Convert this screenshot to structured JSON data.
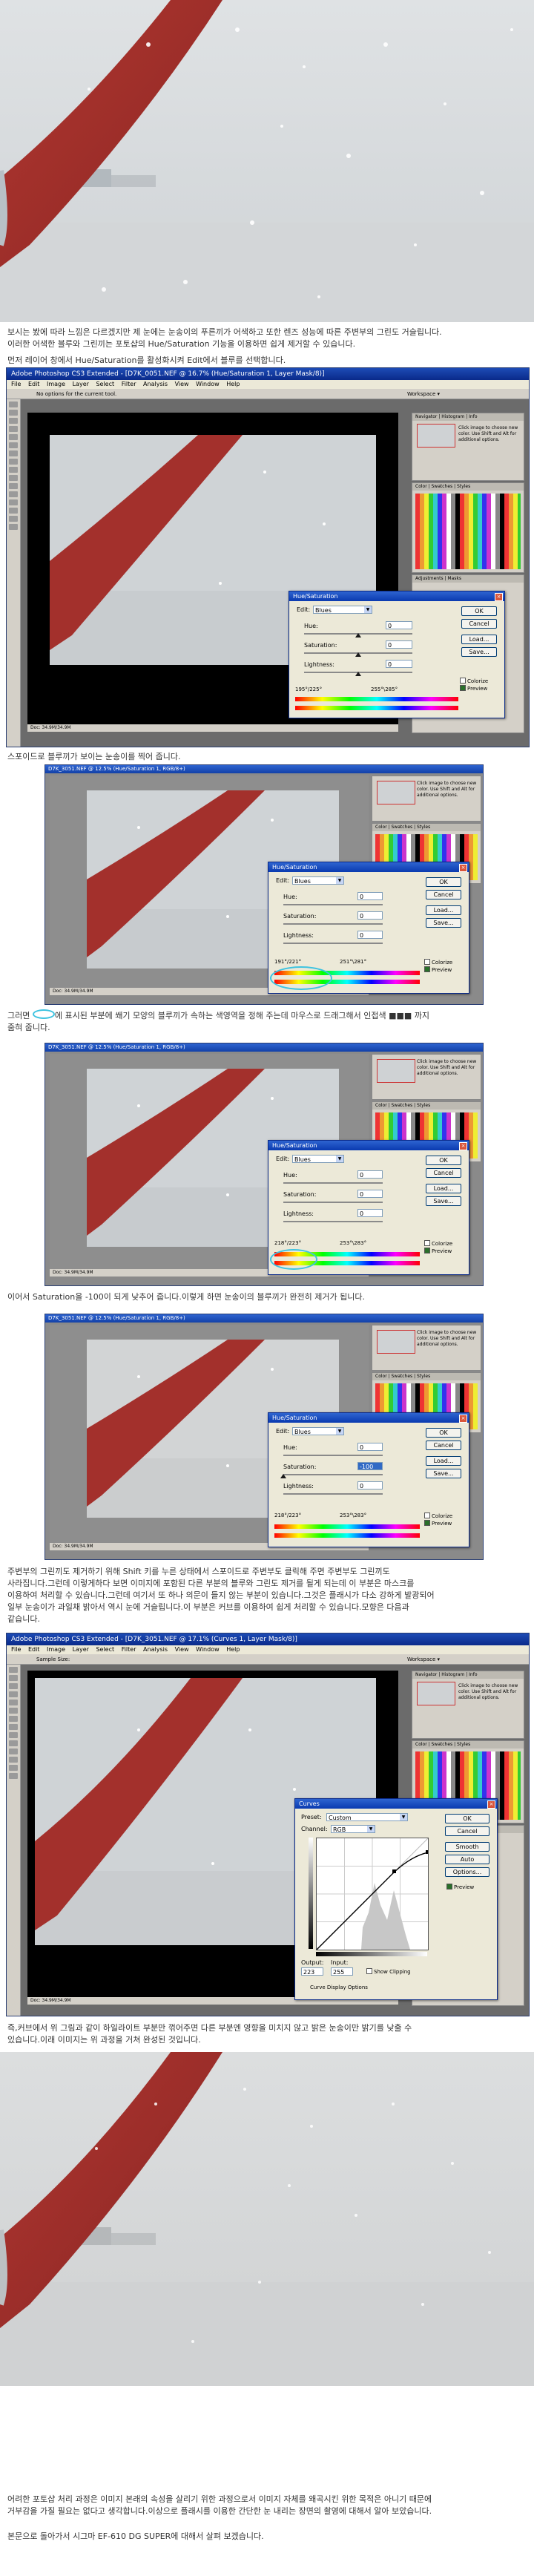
{
  "intro": {
    "line1": "보시는 봤에 따라 느낌은 다르겠지만 제 눈에는 눈송이의 푸른끼가 어색하고 또한 렌즈 성능에 따른 주변부의 그린도 거슬립니다.",
    "line2": "이러한 어색한 블루와 그린끼는 포토샵의 Hue/Saturation 기능을 이용하면 쉽게 제거할 수 있습니다.",
    "line3": "먼저 레이어 창에서 Hue/Saturation를 활성화시켜 Edit에서 블루를 선택합니다."
  },
  "para_select": "스포이드로 블루끼가 보이는 눈송이를 찍어 줍니다.",
  "para_range": {
    "line1_a": "그러면",
    "line1_b": "에 표시된 부분에 쐐기 모양의 블루끼가 속하는 색영역을 정해 주는데 마우스로 드래그해서 인접색 ■■■ 까지",
    "line2": "줌혀 줍니다."
  },
  "para_sat": "이어서 Saturation을 -100이 되게 낮추어 줍니다.이렇게 하면 눈송이의 블루끼가 완전히 제거가 됩니다.",
  "para_curves": {
    "line1": "주변부의 그린끼도 제거하기 위해 Shift 키를 누른 상태에서 스포이드로 주변부도 클릭해 주면 주변부도 그린끼도",
    "line2": "사라집니다.그런데 이렇게하다 보면 이미지에 포함된 다른 부분의 블루와 그린도 제거를 될게 되는데 이 부분은 마스크를",
    "line3": "이용하여 처리할 수 있습니다.그런데 여기서 또 하나 의문이 들지 않는 부분이 있습니다.그것은 플래시가 다소 강하게 발광되어",
    "line4": "일부 눈송이가 과일채 밝아서 역시 눈에 거슬립니다.이 부분은 커브를 이용하여 쉽게 처리할 수 있습니다.모향은 다음과",
    "line5": "같습니다."
  },
  "para_highlight": {
    "line1": "즉,커브에서 위 그림과 같이 하일라이트 부분만 꺾어주면 다른 부분엔 영향을 미치지 않고 밝은 눈송이만 밝기를 낮출 수",
    "line2": "있습니다.이래 이미지는 위 과정을 거쳐 완성된 것입니다."
  },
  "outro": {
    "line1": "어려한 포토샵 처리 과정은 이미지 본래의 속성을 살리기 위한 과정으로서 이미지 자체를 왜곡시킨 위한 목적은 아니기 때문에",
    "line2": "거부감을 가질 필요는 없다고 생각합니다.이상으로 플래시를 이용한 간단한 눈 내리는 장면의 촬영에 대해서 알아 보았습니다.",
    "line3": "본문으로 돌아가서 시그마 EF-610 DG SUPER에 대해서 살펴 보겠습니다."
  },
  "photoshop": {
    "title": "Adobe Photoshop CS3 Extended - [D7K_0051.NEF @ 16.7% (Hue/Saturation 1, Layer Mask/8)]",
    "title_curves": "Adobe Photoshop CS3 Extended - [D7K_3051.NEF @ 17.1% (Curves 1, Layer Mask/8)]",
    "menu": [
      "File",
      "Edit",
      "Image",
      "Layer",
      "Select",
      "Filter",
      "Analysis",
      "View",
      "Window",
      "Help"
    ],
    "options_text": "No options for the current tool.",
    "workspace_label": "Workspace ▾",
    "doc_title_1": "D7K_3051.NEF @ 12.5% (Hue/Saturation 1, RGB/8+)",
    "doc_title_2": "D7K_3051.NEF @ 12.5% (Hue/Saturation 1, RGB/8+)",
    "doc_title_3": "D7K_3051.NEF @ 12.5% (Hue/Saturation 1, RGB/8+)",
    "status": "Doc: 34.9M/34.9M",
    "panel_tabs_nav": "Navigator | Histogram | Info",
    "panel_tabs_color": "Color | Swatches | Styles",
    "panel_tabs_adj": "Adjustments | Masks",
    "panel_hint": "Click image to choose new color. Use Shift and Alt for additional options.",
    "sample_size": "Sample Size:"
  },
  "hue_sat": {
    "title": "Hue/Saturation",
    "edit_label": "Edit:",
    "edit_value": "Blues",
    "hue_label": "Hue:",
    "hue_value": "0",
    "sat_label": "Saturation:",
    "sat_value": "0",
    "sat_value_final": "-100",
    "light_label": "Lightness:",
    "light_value": "0",
    "ok": "OK",
    "cancel": "Cancel",
    "load": "Load...",
    "save": "Save...",
    "colorize": "Colorize",
    "preview": "Preview",
    "range_left": "195°/225°",
    "range_right": "255°\\285°",
    "range_left_2": "191°/221°",
    "range_right_2": "251°\\281°",
    "range_left_3": "218°/223°",
    "range_right_3": "253°\\283°"
  },
  "curves": {
    "title": "Curves",
    "preset_label": "Preset:",
    "preset_value": "Custom",
    "channel_label": "Channel:",
    "channel_value": "RGB",
    "output_label": "Output:",
    "output_value": "223",
    "input_label": "Input:",
    "input_value": "255",
    "show_clipping": "Show Clipping",
    "curve_display": "Curve Display Options",
    "ok": "OK",
    "cancel": "Cancel",
    "smooth": "Smooth",
    "auto": "Auto",
    "options": "Options...",
    "preview": "Preview"
  },
  "colors": {
    "accent_blue": "#0a2a8a",
    "scarf_red": "#a3302c",
    "highlight_ring": "#3ec3e0",
    "snow_bg": "#d7dadc"
  }
}
